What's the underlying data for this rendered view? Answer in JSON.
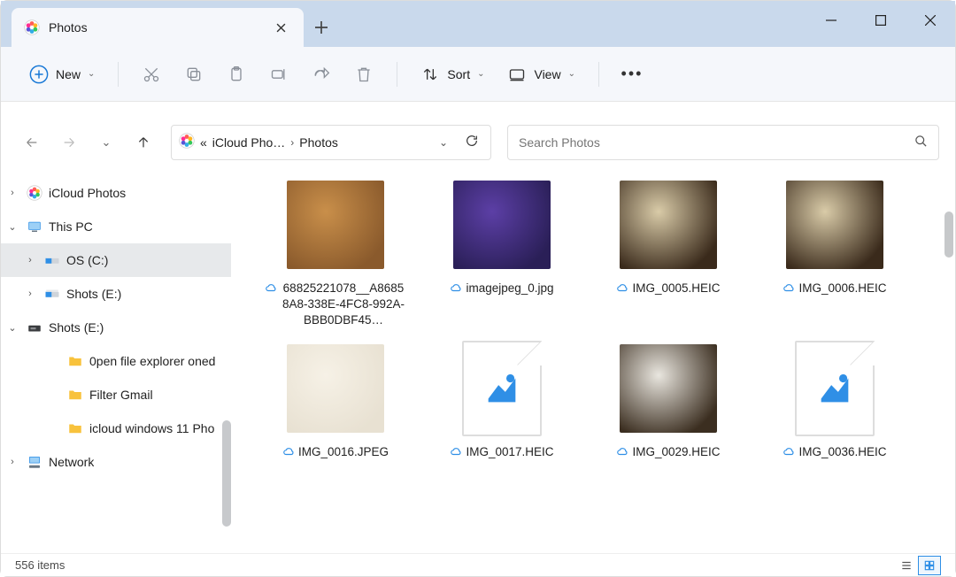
{
  "tab": {
    "title": "Photos"
  },
  "toolbar": {
    "new_label": "New",
    "sort_label": "Sort",
    "view_label": "View"
  },
  "breadcrumbs": {
    "prefix": "«",
    "seg1": "iCloud Pho…",
    "seg2": "Photos"
  },
  "search": {
    "placeholder": "Search Photos"
  },
  "tree": {
    "items": [
      {
        "label": "iCloud Photos",
        "chev": "›",
        "icon": "photos"
      },
      {
        "label": "This PC",
        "chev": "⌄",
        "icon": "pc"
      },
      {
        "label": "OS (C:)",
        "chev": "›",
        "icon": "drive",
        "indent": 1,
        "selected": true
      },
      {
        "label": "Shots (E:)",
        "chev": "›",
        "icon": "drive",
        "indent": 1
      },
      {
        "label": "Shots (E:)",
        "chev": "⌄",
        "icon": "drivex"
      },
      {
        "label": "0pen file explorer oned",
        "chev": "",
        "icon": "folder",
        "indent": 2
      },
      {
        "label": "Filter Gmail",
        "chev": "",
        "icon": "folder",
        "indent": 2
      },
      {
        "label": "icloud windows 11 Pho",
        "chev": "",
        "icon": "folder",
        "indent": 2
      },
      {
        "label": "Network",
        "chev": "›",
        "icon": "network"
      }
    ]
  },
  "files": [
    {
      "name": "68825221078__A86858A8-338E-4FC8-992A-BBB0DBF45…",
      "thumb": "cookies"
    },
    {
      "name": "imagejpeg_0.jpg",
      "thumb": "selfie"
    },
    {
      "name": "IMG_0005.HEIC",
      "thumb": "dog1"
    },
    {
      "name": "IMG_0006.HEIC",
      "thumb": "dog2"
    },
    {
      "name": "IMG_0016.JPEG",
      "thumb": "puppy"
    },
    {
      "name": "IMG_0017.HEIC",
      "thumb": "placeholder"
    },
    {
      "name": "IMG_0029.HEIC",
      "thumb": "cat"
    },
    {
      "name": "IMG_0036.HEIC",
      "thumb": "placeholder"
    }
  ],
  "status": {
    "item_count": "556 items"
  },
  "thumb_colors": {
    "cookies": {
      "a": "#8a5a2c",
      "b": "#c98f4a"
    },
    "selfie": {
      "a": "#2a1f57",
      "b": "#5c3fa6"
    },
    "dog1": {
      "a": "#3a2a1b",
      "b": "#d9cba8"
    },
    "dog2": {
      "a": "#3a2a1b",
      "b": "#d9cba8"
    },
    "puppy": {
      "a": "#e8e1d2",
      "b": "#f6f1e6"
    },
    "cat": {
      "a": "#3b2e20",
      "b": "#e9e6df"
    }
  }
}
